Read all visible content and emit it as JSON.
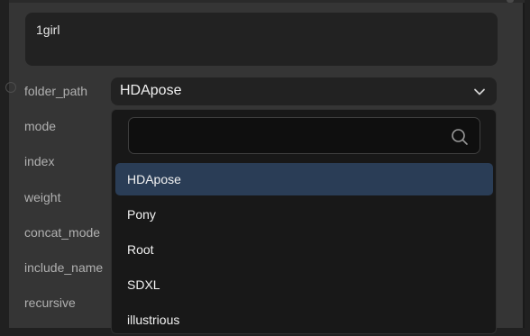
{
  "prompt_text": "1girl",
  "widgets": [
    {
      "label": "folder_path",
      "value": "HDApose"
    },
    {
      "label": "mode"
    },
    {
      "label": "index"
    },
    {
      "label": "weight"
    },
    {
      "label": "concat_mode"
    },
    {
      "label": "include_name"
    },
    {
      "label": "recursive"
    }
  ],
  "dropdown": {
    "search_value": "",
    "search_placeholder": "",
    "search_icon": "search-icon",
    "options": [
      "HDApose",
      "Pony",
      "Root",
      "SDXL",
      "illustrious"
    ],
    "selected": "HDApose"
  },
  "colors": {
    "node_bg": "#353535",
    "widget_bg": "#222222",
    "dropdown_bg": "#181818",
    "selected_bg": "#2a3d56"
  }
}
